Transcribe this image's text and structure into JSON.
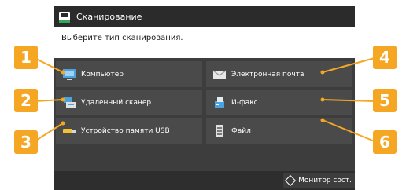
{
  "window": {
    "title": "Сканирование"
  },
  "prompt": "Выберите тип сканирования.",
  "buttons": [
    {
      "label": "Компьютер",
      "icon": "computer-icon"
    },
    {
      "label": "Электронная почта",
      "icon": "email-icon"
    },
    {
      "label": "Удаленный сканер",
      "icon": "remote-scanner-icon"
    },
    {
      "label": "И-факс",
      "icon": "ifax-icon"
    },
    {
      "label": "Устройство памяти USB",
      "icon": "usb-icon"
    },
    {
      "label": "Файл",
      "icon": "file-icon"
    }
  ],
  "status_bar": {
    "monitor_label": "Монитор сост."
  },
  "callouts": [
    "1",
    "2",
    "3",
    "4",
    "5",
    "6"
  ],
  "colors": {
    "accent": "#f5a623",
    "panel": "#3a3a3a",
    "button": "#4a4a4a"
  }
}
